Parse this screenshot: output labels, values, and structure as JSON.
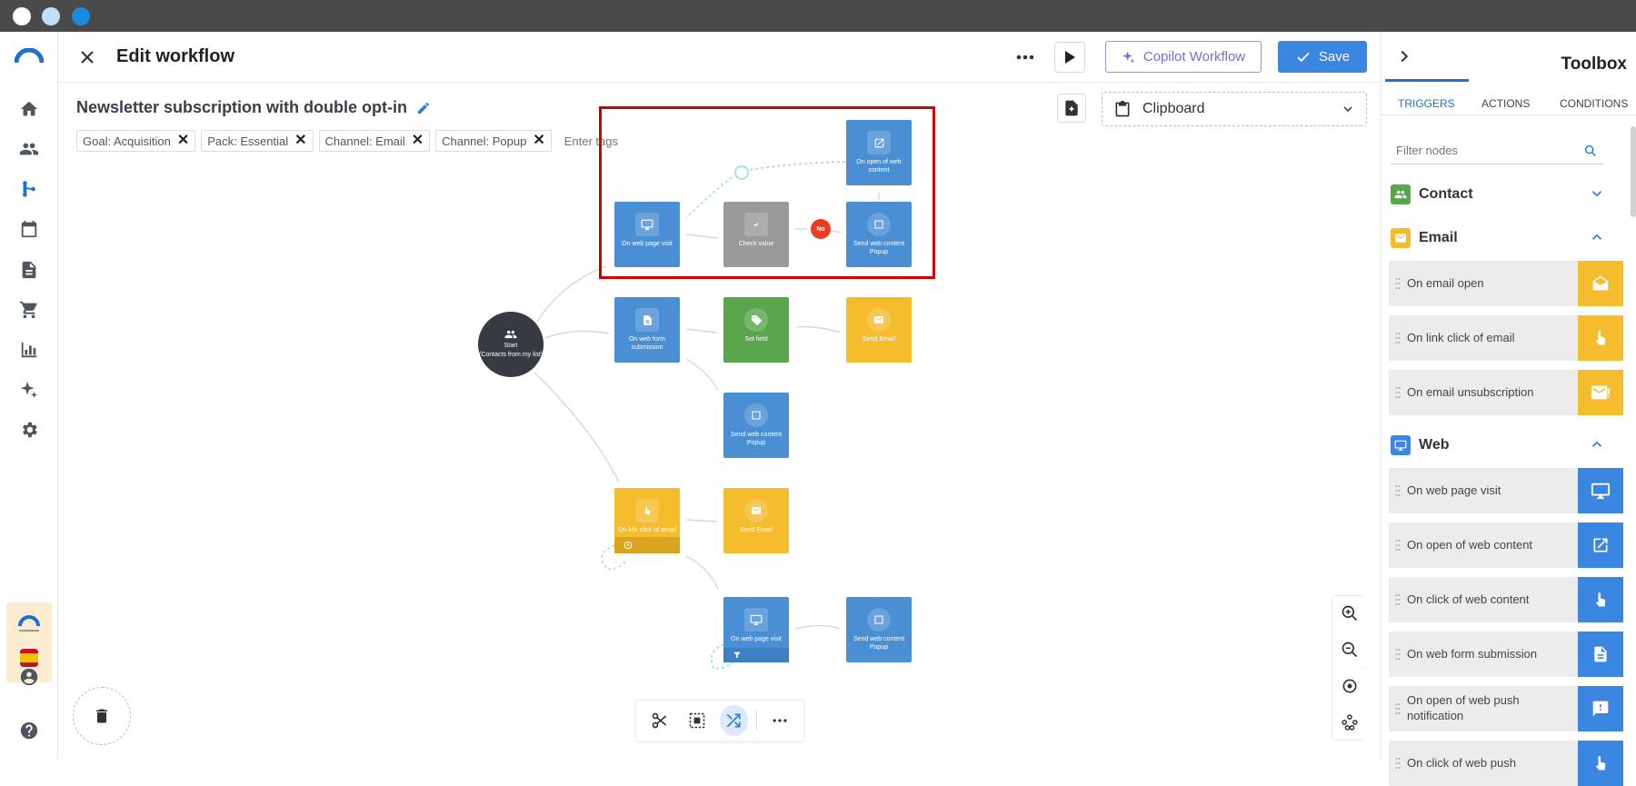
{
  "header": {
    "title": "Edit workflow",
    "copilot_label": "Copilot Workflow",
    "save_label": "Save"
  },
  "workflow": {
    "name": "Newsletter subscription with double opt-in",
    "tags": [
      "Goal: Acquisition",
      "Pack: Essential",
      "Channel: Email",
      "Channel: Popup"
    ],
    "tags_placeholder": "Enter tags"
  },
  "clipboard": {
    "label": "Clipboard"
  },
  "nodes": {
    "start": {
      "line1": "Start",
      "line2": "(Contacts from my list)"
    },
    "web_page_visit": "On web page visit",
    "check_value": "Check value",
    "send_popup_1": "Send web content Popup",
    "open_web_content": "On open of web content",
    "no_badge": "No",
    "web_form": "On web form submission",
    "set_field": "Set field",
    "send_email_1": "Send Email",
    "send_popup_2": "Send web content Popup",
    "link_click": "On link click of email",
    "send_email_2": "Send Email",
    "web_page_visit_2": "On web page visit",
    "send_popup_3": "Send web content Popup"
  },
  "toolbox": {
    "title": "Toolbox",
    "tabs": [
      "TRIGGERS",
      "ACTIONS",
      "CONDITIONS"
    ],
    "filter_placeholder": "Filter nodes",
    "categories": {
      "contact": "Contact",
      "email": "Email",
      "web": "Web"
    },
    "email_items": [
      "On email open",
      "On link click of email",
      "On email unsubscription"
    ],
    "web_items": [
      "On web page visit",
      "On open of web content",
      "On click of web content",
      "On web form submission",
      "On open of web push notification",
      "On click of web push"
    ]
  },
  "colors": {
    "accent": "#3b86e0",
    "highlight": "#d10000",
    "node_blue": "#4a8fd3",
    "node_yellow": "#f5bc2e",
    "node_green": "#5aa64c",
    "node_gray": "#9a9a9a"
  }
}
